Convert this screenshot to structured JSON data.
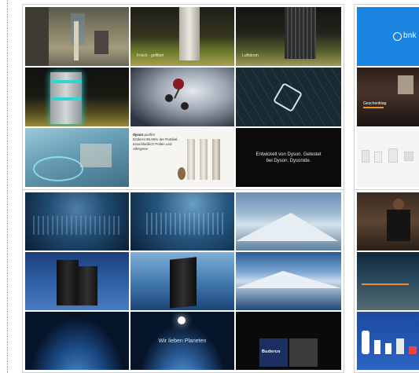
{
  "boards": {
    "dyson": {
      "tiles": [
        {
          "name": "home-scene"
        },
        {
          "name": "purifier-meadow"
        },
        {
          "name": "purifier-dark-meadow"
        },
        {
          "name": "appliance-teal-glow"
        },
        {
          "name": "molecule-graphic"
        },
        {
          "name": "hexagon-filter"
        },
        {
          "name": "room-airflow-visual"
        },
        {
          "name": "product-lineup-ad"
        },
        {
          "name": "end-card"
        }
      ],
      "ad": {
        "brand": "dyson",
        "tagline": "purifier",
        "headline": "Entfernt 99,95% der Partikel, einschließlich Pollen und Allergene"
      },
      "end_text": "Entwickelt von Dyson. Getestet bei Dyson. Dysonide."
    },
    "buderus": {
      "tiles": [
        {
          "name": "underwater-fish-1"
        },
        {
          "name": "underwater-fish-2"
        },
        {
          "name": "icy-mountains"
        },
        {
          "name": "heating-unit-1"
        },
        {
          "name": "heating-unit-2"
        },
        {
          "name": "lake-mountains"
        },
        {
          "name": "earth-from-space-1"
        },
        {
          "name": "earth-from-space-2"
        },
        {
          "name": "brand-end-card"
        }
      ],
      "earth_caption": "Wir lieben Planeten",
      "brand": "Buderus"
    },
    "bnk": {
      "logo_text": "bnk",
      "caption": "Geschenktag"
    }
  }
}
